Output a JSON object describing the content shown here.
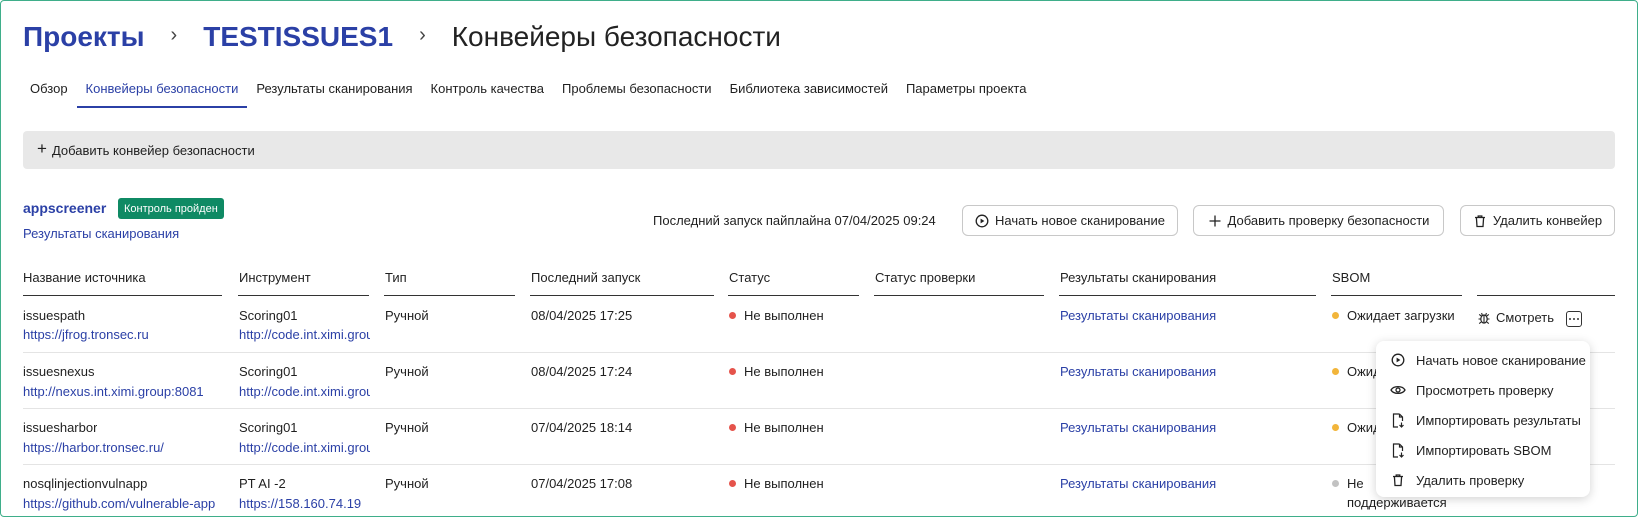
{
  "breadcrumb": {
    "projects": "Проекты",
    "project": "TESTISSUES1",
    "current": "Конвейеры безопасности",
    "separator": "›"
  },
  "tabs": [
    {
      "label": "Обзор",
      "active": false
    },
    {
      "label": "Конвейеры безопасности",
      "active": true
    },
    {
      "label": "Результаты сканирования",
      "active": false
    },
    {
      "label": "Контроль качества",
      "active": false
    },
    {
      "label": "Проблемы безопасности",
      "active": false
    },
    {
      "label": "Библиотека зависимостей",
      "active": false
    },
    {
      "label": "Параметры проекта",
      "active": false
    }
  ],
  "add_pipeline": {
    "icon": "plus-icon",
    "label": "Добавить конвейер безопасности"
  },
  "pipeline": {
    "name": "appscreener",
    "badge": "Контроль пройден",
    "results_link": "Результаты сканирования",
    "last_run": "Последний запуск пайплайна 07/04/2025 09:24",
    "buttons": {
      "start_scan": "Начать новое сканирование",
      "add_check": "Добавить проверку безопасности",
      "delete": "Удалить конвейер"
    }
  },
  "table": {
    "columns": [
      "Название источника",
      "Инструмент",
      "Тип",
      "Последний запуск",
      "Статус",
      "Статус проверки",
      "Результаты сканирования",
      "SBOM"
    ],
    "rows": [
      {
        "source": "issuespath",
        "source_url": "https://jfrog.tronsec.ru",
        "tool": "Scoring01",
        "tool_url": "http://code.int.ximi.group",
        "type": "Ручной",
        "last_run": "08/04/2025 17:25",
        "status": "Не выполнен",
        "check_status": "",
        "results": "Результаты сканирования",
        "sbom": "Ожидает загрузки",
        "sbom_dot": "yellow"
      },
      {
        "source": "issuesnexus",
        "source_url": "http://nexus.int.ximi.group:8081",
        "tool": "Scoring01",
        "tool_url": "http://code.int.ximi.group",
        "type": "Ручной",
        "last_run": "08/04/2025 17:24",
        "status": "Не выполнен",
        "check_status": "",
        "results": "Результаты сканирования",
        "sbom": "Ожида",
        "sbom_dot": "yellow"
      },
      {
        "source": "issuesharbor",
        "source_url": "https://harbor.tronsec.ru/",
        "tool": "Scoring01",
        "tool_url": "http://code.int.ximi.group",
        "type": "Ручной",
        "last_run": "07/04/2025 18:14",
        "status": "Не выполнен",
        "check_status": "",
        "results": "Результаты сканирования",
        "sbom": "Ожида",
        "sbom_dot": "yellow"
      },
      {
        "source": "nosqlinjectionvulnapp",
        "source_url": "https://github.com/vulnerable-app",
        "tool": "PT AI -2",
        "tool_url": "https://158.160.74.19",
        "type": "Ручной",
        "last_run": "07/04/2025 17:08",
        "status": "Не выполнен",
        "check_status": "",
        "results": "Результаты сканирования",
        "sbom": "Не",
        "sbom_line2": "поддерживается",
        "sbom_dot": "grey"
      }
    ],
    "view_button": "Смотреть"
  },
  "menu": [
    {
      "icon": "play-circle-icon",
      "label": "Начать новое сканирование"
    },
    {
      "icon": "eye-icon",
      "label": "Просмотреть проверку"
    },
    {
      "icon": "file-import-icon",
      "label": "Импортировать результаты"
    },
    {
      "icon": "file-import-icon",
      "label": "Импортировать SBOM"
    },
    {
      "icon": "trash-icon",
      "label": "Удалить проверку"
    }
  ],
  "colors": {
    "accent": "#2b40a6",
    "badge": "#0f8a64",
    "status_failed": "#e5534b",
    "sbom_pending": "#f2b53a",
    "sbom_unsupported": "#c2c2c2"
  }
}
